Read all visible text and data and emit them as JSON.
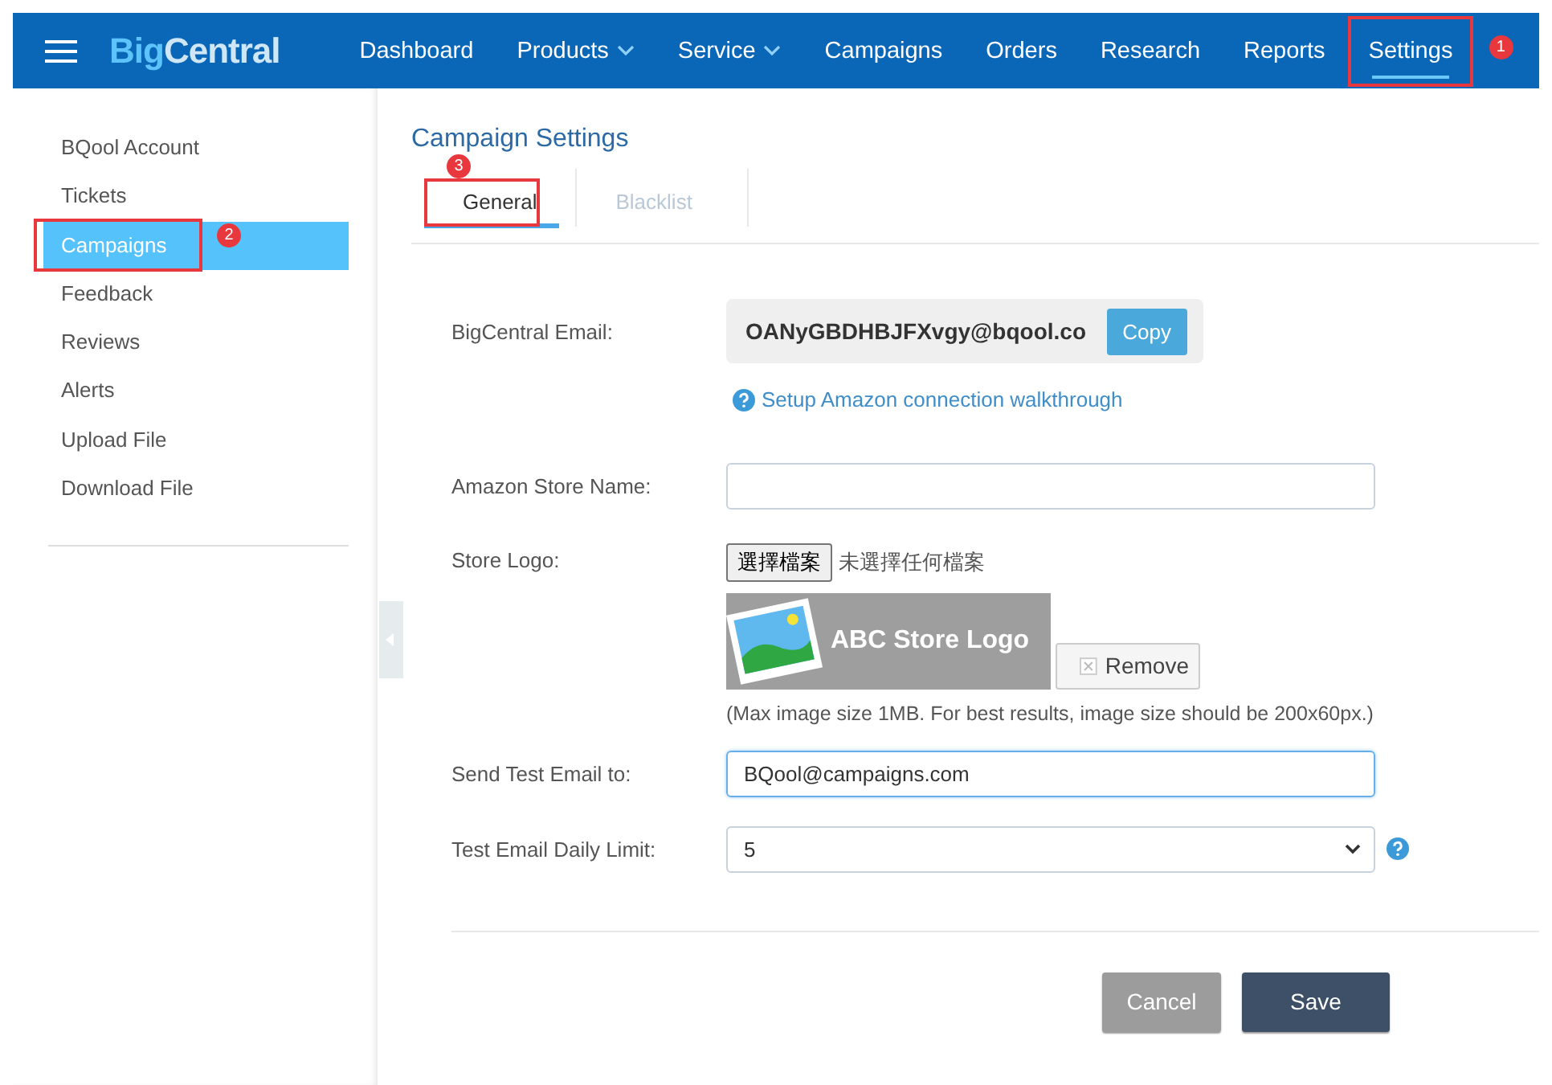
{
  "nav": {
    "logo": [
      "Big",
      "Central"
    ],
    "items": [
      {
        "label": "Dashboard",
        "dropdown": false,
        "selected": false
      },
      {
        "label": "Products",
        "dropdown": true,
        "selected": false
      },
      {
        "label": "Service",
        "dropdown": true,
        "selected": false
      },
      {
        "label": "Campaigns",
        "dropdown": false,
        "selected": false
      },
      {
        "label": "Orders",
        "dropdown": false,
        "selected": false
      },
      {
        "label": "Research",
        "dropdown": false,
        "selected": false
      },
      {
        "label": "Reports",
        "dropdown": false,
        "selected": false
      },
      {
        "label": "Settings",
        "dropdown": false,
        "selected": true,
        "annotation": "1"
      }
    ]
  },
  "sidebar": {
    "items": [
      {
        "label": "BQool Account",
        "selected": false
      },
      {
        "label": "Tickets",
        "selected": false
      },
      {
        "label": "Campaigns",
        "selected": true,
        "annotation": "2"
      },
      {
        "label": "Feedback",
        "selected": false
      },
      {
        "label": "Reviews",
        "selected": false
      },
      {
        "label": "Alerts",
        "selected": false
      },
      {
        "label": "Upload File",
        "selected": false
      },
      {
        "label": "Download File",
        "selected": false
      }
    ]
  },
  "title": "Campaign Settings",
  "tabs": [
    {
      "label": "General",
      "selected": true,
      "annotation": "3"
    },
    {
      "label": "Blacklist",
      "selected": false
    }
  ],
  "form": {
    "rows": [
      {
        "kind": "copy",
        "label": "BigCentral Email:",
        "value": "OANyGBDHBJFXvgy@bqool.co",
        "button": "Copy",
        "link": "Setup Amazon connection walkthrough"
      },
      {
        "kind": "text",
        "label": "Amazon Store Name:",
        "focused": false
      },
      {
        "kind": "file",
        "label": "Store Logo:",
        "button": "選擇檔案",
        "status": "未選擇任何檔案",
        "logo_text": "ABC Store Logo",
        "remove": "Remove",
        "hint": "(Max image size 1MB. For best results, image size should be 200x60px.)"
      },
      {
        "kind": "text",
        "label": "Send Test Email to:",
        "value": "BQool@campaigns.com",
        "focused": true
      },
      {
        "kind": "select",
        "label": "Test Email Daily Limit:",
        "value": "5",
        "help": true
      }
    ],
    "buttons": [
      {
        "label": "Cancel",
        "disabled": true
      },
      {
        "label": "Save",
        "disabled": false
      }
    ]
  }
}
